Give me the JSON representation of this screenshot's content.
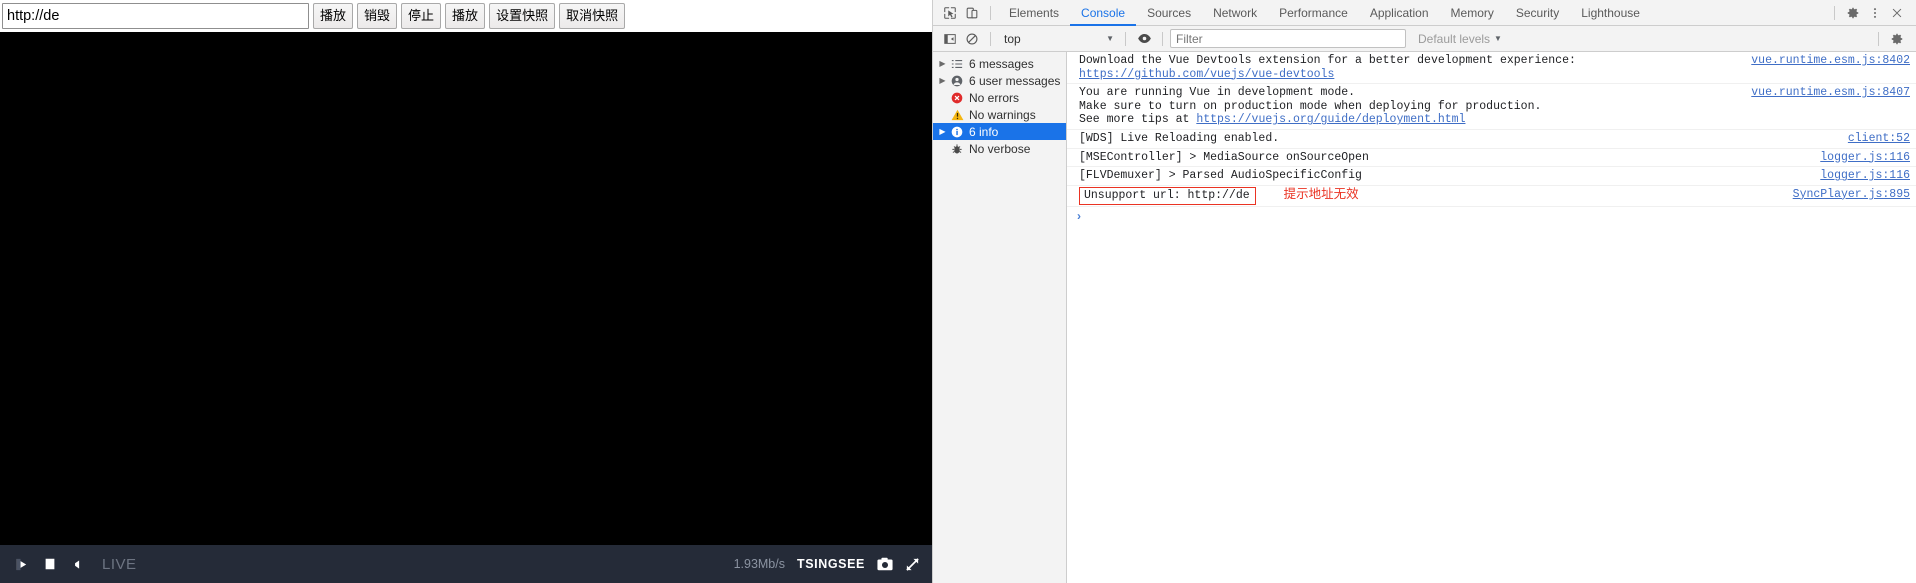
{
  "player": {
    "url_value": "http://de",
    "url_placeholder": "",
    "buttons": [
      {
        "label": "播放",
        "name": "play-button"
      },
      {
        "label": "销毁",
        "name": "destroy-button"
      },
      {
        "label": "停止",
        "name": "stop-button"
      },
      {
        "label": "播放",
        "name": "play-button-2"
      },
      {
        "label": "设置快照",
        "name": "set-snapshot-button"
      },
      {
        "label": "取消快照",
        "name": "cancel-snapshot-button"
      }
    ],
    "controls": {
      "live_label": "LIVE",
      "bitrate": "1.93Mb/s",
      "brand": "TSINGSEE",
      "play_icon": "play-icon",
      "stop_icon": "stop-icon",
      "volume_icon": "volume-icon",
      "snapshot_icon": "camera-icon",
      "fullscreen_icon": "fullscreen-icon"
    },
    "colors": {
      "bar_bg": "#252b38",
      "video_bg": "#000000",
      "live_text": "#6d7482"
    }
  },
  "devtools": {
    "toolbar_icons": {
      "inspect": "inspect-element-icon",
      "device": "device-toolbar-icon",
      "settings": "gear-icon",
      "more": "kebab-menu-icon",
      "close": "close-icon"
    },
    "tabs": [
      {
        "label": "Elements",
        "active": false
      },
      {
        "label": "Console",
        "active": true
      },
      {
        "label": "Sources",
        "active": false
      },
      {
        "label": "Network",
        "active": false
      },
      {
        "label": "Performance",
        "active": false
      },
      {
        "label": "Application",
        "active": false
      },
      {
        "label": "Memory",
        "active": false
      },
      {
        "label": "Security",
        "active": false
      },
      {
        "label": "Lighthouse",
        "active": false
      }
    ],
    "console_toolbar": {
      "sidebar_toggle_icon": "console-sidebar-icon",
      "clear_icon": "clear-console-icon",
      "context": "top",
      "eye_icon": "live-expression-icon",
      "filter_value": "",
      "filter_placeholder": "Filter",
      "levels_label": "Default levels",
      "settings_icon": "gear-icon"
    },
    "sidebar": [
      {
        "label": "6 messages",
        "icon": "list-icon",
        "arrow": true,
        "selected": false
      },
      {
        "label": "6 user messages",
        "icon": "user-icon",
        "arrow": true,
        "selected": false
      },
      {
        "label": "No errors",
        "icon": "error-icon",
        "arrow": false,
        "selected": false
      },
      {
        "label": "No warnings",
        "icon": "warning-icon",
        "arrow": false,
        "selected": false
      },
      {
        "label": "6 info",
        "icon": "info-icon",
        "arrow": true,
        "selected": true
      },
      {
        "label": "No verbose",
        "icon": "bug-icon",
        "arrow": false,
        "selected": false
      }
    ],
    "logs": [
      {
        "lines": [
          "Download the Vue Devtools extension for a better development experience:"
        ],
        "link": "https://github.com/vuejs/vue-devtools",
        "source": "vue.runtime.esm.js:8402"
      },
      {
        "lines": [
          "You are running Vue in development mode.",
          "Make sure to turn on production mode when deploying for production."
        ],
        "tail_prefix": "See more tips at ",
        "link": "https://vuejs.org/guide/deployment.html",
        "source": "vue.runtime.esm.js:8407"
      },
      {
        "lines": [
          "[WDS] Live Reloading enabled."
        ],
        "source": "client:52"
      },
      {
        "lines": [
          "[MSEController] > MediaSource onSourceOpen"
        ],
        "source": "logger.js:116"
      },
      {
        "lines": [
          "[FLVDemuxer] > Parsed AudioSpecificConfig"
        ],
        "source": "logger.js:116"
      },
      {
        "lines": [
          "Unsupport url: http://de"
        ],
        "boxed": true,
        "annotation": "提示地址无效",
        "source": "SyncPlayer.js:895"
      }
    ],
    "prompt_caret": "›",
    "colors": {
      "accent": "#1a73e8",
      "link": "#3f6ec6",
      "highlight_box": "#ea3323",
      "annotation": "#ea3323",
      "chrome_bg": "#f3f3f3"
    }
  }
}
